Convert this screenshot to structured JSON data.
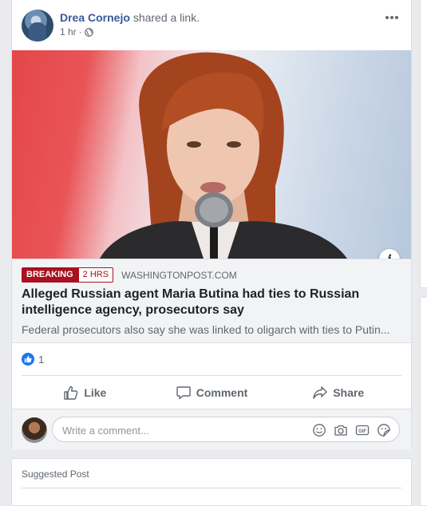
{
  "post": {
    "author": "Drea Cornejo",
    "action": "shared a link.",
    "time": "1 hr",
    "more_icon": "ellipsis-icon",
    "privacy_icon": "globe-icon"
  },
  "link": {
    "breaking_label": "BREAKING",
    "age_label": "2 HRS",
    "domain": "WASHINGTONPOST.COM",
    "headline": "Alleged Russian agent Maria Butina had ties to Russian intelligence agency, prosecutors say",
    "description": "Federal prosecutors also say she was linked to oligarch with ties to Putin...",
    "info_icon": "i"
  },
  "reactions": {
    "count": "1",
    "icon": "like-reaction-icon"
  },
  "actions": {
    "like": "Like",
    "comment": "Comment",
    "share": "Share"
  },
  "comment": {
    "placeholder": "Write a comment...",
    "icons": [
      "emoji-icon",
      "camera-icon",
      "gif-icon",
      "sticker-icon"
    ]
  },
  "suggested": {
    "title": "Suggested Post"
  },
  "colors": {
    "link_blue": "#385898",
    "breaking_red": "#a8111f",
    "like_blue": "#1877f2",
    "background": "#e9ebee"
  }
}
